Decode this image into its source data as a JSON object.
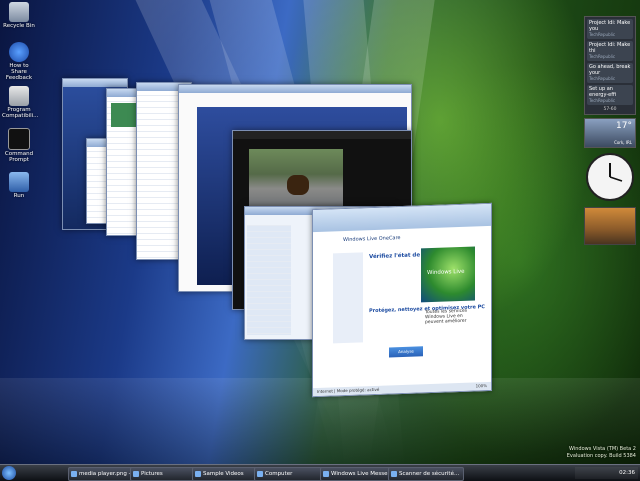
{
  "desktop_icons": [
    {
      "label": "Recycle Bin"
    },
    {
      "label": "How to Share Feedback"
    },
    {
      "label": "Program Compatibili..."
    },
    {
      "label": "Command Prompt"
    },
    {
      "label": "Run"
    }
  ],
  "gadgets": {
    "feed_items": [
      {
        "title": "Project Idi: Make you",
        "source": "TechRepublic"
      },
      {
        "title": "Project Idi: Make thi",
        "source": "TechRepublic"
      },
      {
        "title": "Go ahead, break your",
        "source": "TechRepublic"
      },
      {
        "title": "Set up an energy-effi",
        "source": "TechRepublic"
      }
    ],
    "feed_pager": "57-60",
    "weather_temp": "17°",
    "weather_city": "Cork, IRL"
  },
  "front_window": {
    "brand": "Windows Live OneCare",
    "heading": "Vérifiez l'état de votre PC !",
    "subheading": "Protégez, nettoyez et optimisez votre PC",
    "side_heading": "Toutes les services Windows Live en peuvent améliorer",
    "action_button": "Analyse complète",
    "logo": "Windows Live",
    "status": "Internet | Mode protégé: activé",
    "zoom": "100%"
  },
  "watermark": {
    "line1": "Windows Vista (TM) Beta 2",
    "line2": "Evaluation copy. Build 5384"
  },
  "taskbar": {
    "items": [
      {
        "label": "media player.png - ..."
      },
      {
        "label": "Pictures"
      },
      {
        "label": "Sample Videos"
      },
      {
        "label": "Computer"
      },
      {
        "label": "Windows Live Messe..."
      },
      {
        "label": "Scanner de sécurité..."
      }
    ],
    "clock": "02:36"
  },
  "colors": {
    "accent": "#4fa3ff",
    "taskbar": "#1a1d24",
    "vista_green": "#6cc33b"
  }
}
